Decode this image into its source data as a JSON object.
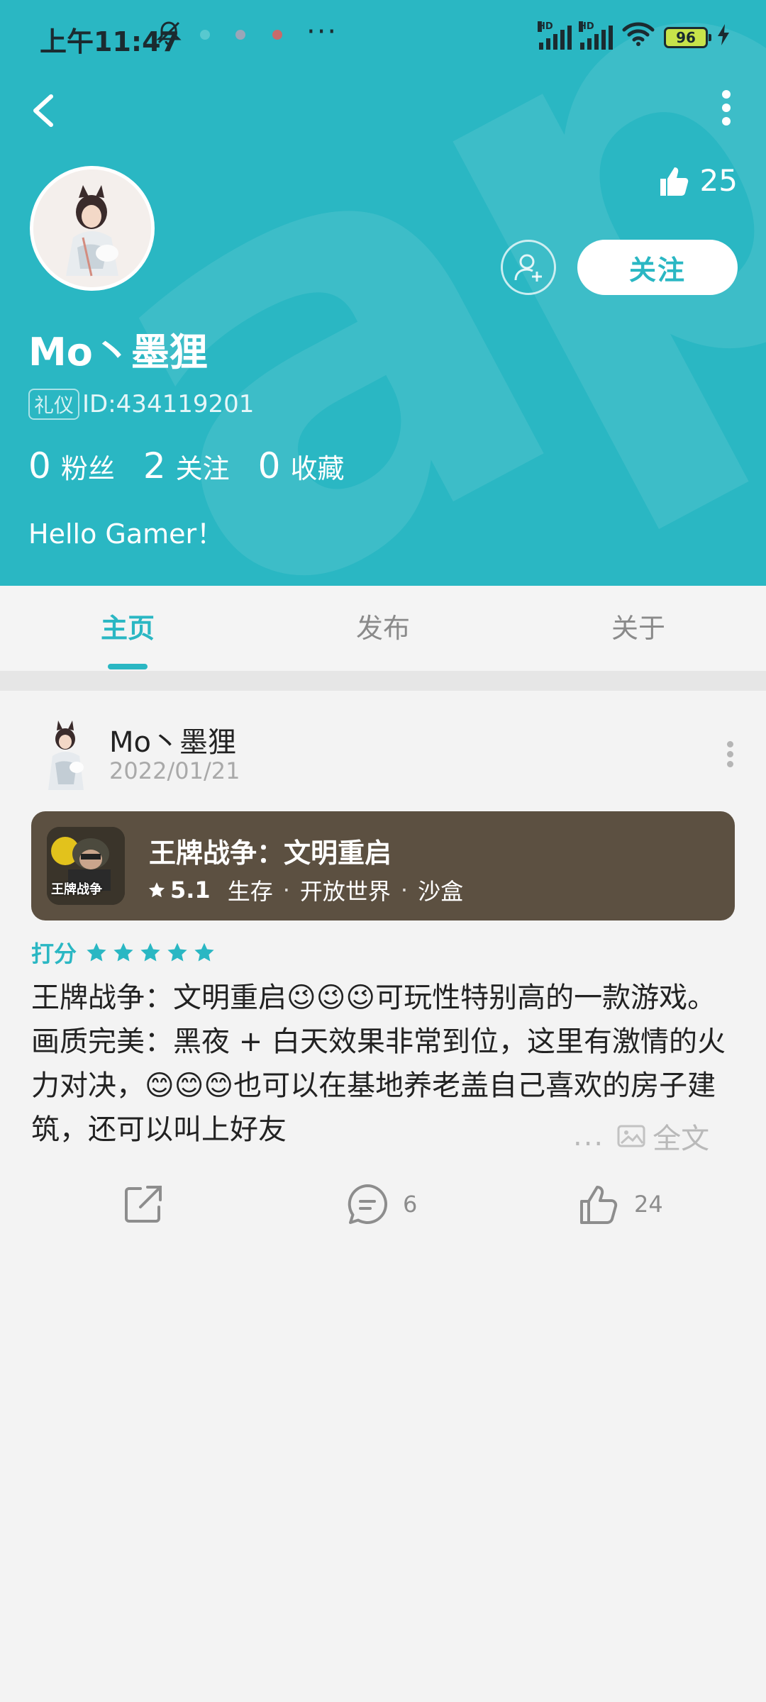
{
  "status_bar": {
    "time": "上午11:47",
    "network_label": "HD",
    "battery": "96"
  },
  "profile": {
    "likes_count": "25",
    "follow_button": "关注",
    "username": "Mo丶墨狸",
    "badge": "礼仪",
    "id_text": "ID:434119201",
    "stats": [
      {
        "value": "0",
        "label": "粉丝"
      },
      {
        "value": "2",
        "label": "关注"
      },
      {
        "value": "0",
        "label": "收藏"
      }
    ],
    "bio": "Hello Gamer！"
  },
  "tabs": [
    {
      "label": "主页",
      "active": true
    },
    {
      "label": "发布",
      "active": false
    },
    {
      "label": "关于",
      "active": false
    }
  ],
  "post": {
    "author": "Mo丶墨狸",
    "date": "2022/01/21",
    "game": {
      "title": "王牌战争：文明重启",
      "score": "5.1",
      "tags": [
        "生存",
        "开放世界",
        "沙盒"
      ],
      "icon_text": "王牌战争"
    },
    "rating_label": "打分",
    "rating_stars": 5,
    "body": "王牌战争：文明重启😉😉😉可玩性特别高的一款游戏。画质完美：黑夜 + 白天效果非常到位，这里有激情的火力对决，😊😊😊也可以在基地养老盖自己喜欢的房子建筑，还可以叫上好友",
    "ellipsis": "...",
    "full_text_label": "全文",
    "comments_count": "6",
    "likes_count": "24"
  },
  "colors": {
    "accent": "#2ab7c3",
    "game_card": "#5c5041",
    "background": "#f3f3f3"
  }
}
